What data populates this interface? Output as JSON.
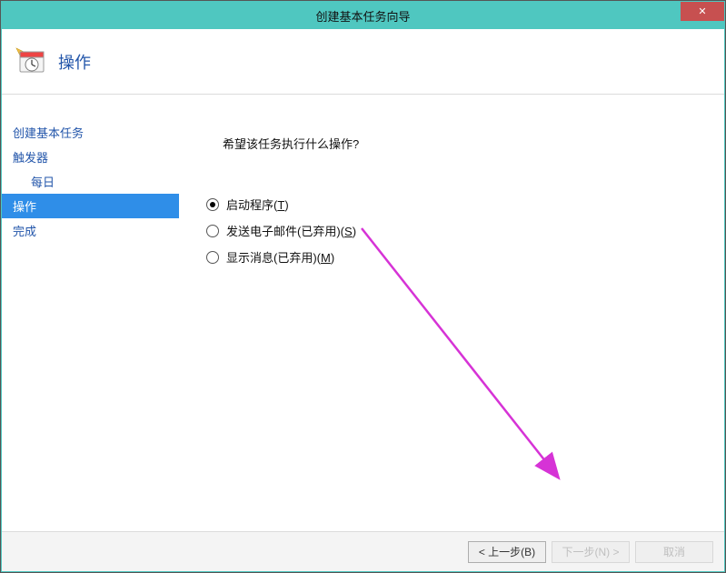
{
  "window": {
    "title": "创建基本任务向导",
    "close": "✕"
  },
  "header": {
    "title": "操作"
  },
  "sidebar": {
    "items": [
      {
        "label": "创建基本任务",
        "indent": false,
        "active": false
      },
      {
        "label": "触发器",
        "indent": false,
        "active": false
      },
      {
        "label": "每日",
        "indent": true,
        "active": false
      },
      {
        "label": "操作",
        "indent": false,
        "active": true
      },
      {
        "label": "完成",
        "indent": false,
        "active": false
      }
    ]
  },
  "content": {
    "question": "希望该任务执行什么操作?",
    "options": [
      {
        "label": "启动程序",
        "hotkey": "T",
        "checked": true
      },
      {
        "label": "发送电子邮件(已弃用)",
        "hotkey": "S",
        "checked": false
      },
      {
        "label": "显示消息(已弃用)",
        "hotkey": "M",
        "checked": false
      }
    ]
  },
  "footer": {
    "back": "< 上一步(B)",
    "next": "下一步(N) >",
    "cancel": "取消"
  }
}
